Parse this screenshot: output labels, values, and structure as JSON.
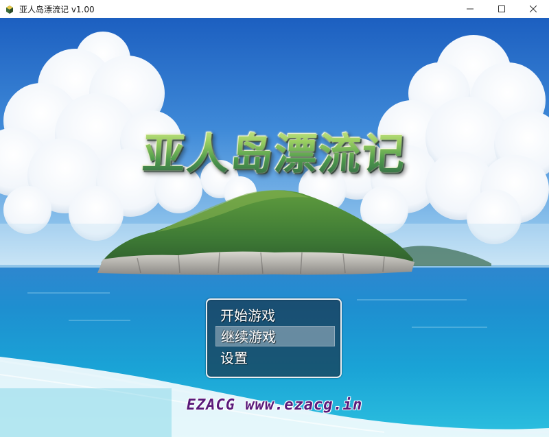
{
  "window": {
    "title": "亚人岛漂流记 v1.00",
    "minimize_icon": "minimize-icon",
    "maximize_icon": "maximize-icon",
    "close_icon": "close-icon"
  },
  "game": {
    "title_logo": "亚人岛漂流记",
    "menu": {
      "items": [
        {
          "label": "开始游戏"
        },
        {
          "label": "继续游戏"
        },
        {
          "label": "设置"
        }
      ],
      "selected_index": 1
    },
    "watermark": "EZACG www.ezacg.in"
  },
  "colors": {
    "sky_top": "#1f64c4",
    "sea": "#1f8fc8",
    "title_green": "#4e9a4c",
    "watermark": "#5a1a7a"
  }
}
